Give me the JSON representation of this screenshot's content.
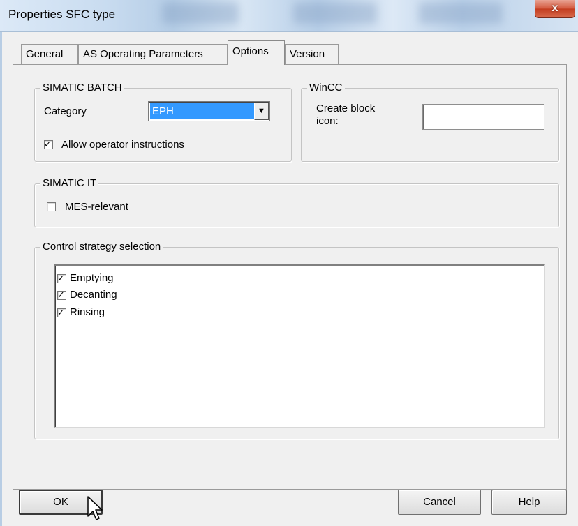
{
  "window": {
    "title": "Properties SFC type",
    "close_glyph": "x"
  },
  "tabs": [
    {
      "label": "General",
      "active": false
    },
    {
      "label": "AS Operating Parameters",
      "active": false
    },
    {
      "label": "Options",
      "active": true
    },
    {
      "label": "Version",
      "active": false
    }
  ],
  "simatic_batch": {
    "title": "SIMATIC BATCH",
    "category_label": "Category",
    "category_value": "EPH",
    "allow_operator_label": "Allow operator instructions",
    "allow_operator_checked": true
  },
  "wincc": {
    "title": "WinCC",
    "create_block_icon_label_line1": "Create block",
    "create_block_icon_label_line2": "icon:",
    "create_block_icon_value": ""
  },
  "simatic_it": {
    "title": "SIMATIC IT",
    "mes_relevant_label": "MES-relevant",
    "mes_relevant_checked": false
  },
  "control_strategy": {
    "title": "Control strategy selection",
    "items": [
      {
        "label": "Emptying",
        "checked": true
      },
      {
        "label": "Decanting",
        "checked": true
      },
      {
        "label": "Rinsing",
        "checked": true
      }
    ]
  },
  "buttons": {
    "ok": "OK",
    "cancel": "Cancel",
    "help": "Help"
  },
  "icons": {
    "check": "✓",
    "dropdown": "▼"
  },
  "colors": {
    "selection": "#3399ff",
    "close_button": "#c9462a"
  }
}
